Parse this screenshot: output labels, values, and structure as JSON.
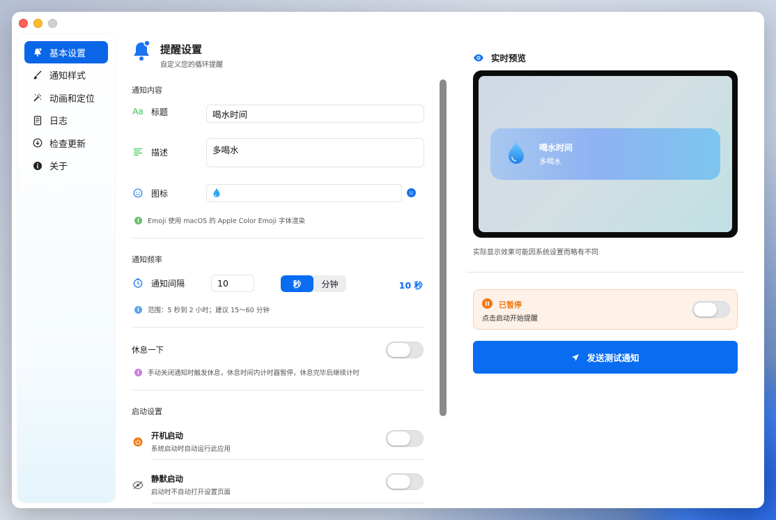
{
  "sidebar": {
    "items": [
      {
        "label": "基本设置",
        "icon": "bell-badge-icon"
      },
      {
        "label": "通知样式",
        "icon": "paintbrush-icon"
      },
      {
        "label": "动画和定位",
        "icon": "magic-wand-icon"
      },
      {
        "label": "日志",
        "icon": "document-icon"
      },
      {
        "label": "检查更新",
        "icon": "download-circle-icon"
      },
      {
        "label": "关于",
        "icon": "info-icon"
      }
    ]
  },
  "header": {
    "title": "提醒设置",
    "subtitle": "自定义您的循环提醒"
  },
  "content": {
    "section_label": "通知内容",
    "title_label": "标题",
    "title_value": "喝水时间",
    "desc_label": "描述",
    "desc_value": "多喝水",
    "icon_label": "图标",
    "icon_value": "💧",
    "emoji_hint": "Emoji 使用 macOS 的 Apple Color Emoji 字体渲染"
  },
  "frequency": {
    "section_label": "通知频率",
    "interval_label": "通知间隔",
    "interval_value": "10",
    "unit_seconds": "秒",
    "unit_minutes": "分钟",
    "selected_unit": "秒",
    "summary": "10 秒",
    "hint": "范围：5 秒到 2 小时；建议 15～60 分钟"
  },
  "rest": {
    "label": "休息一下",
    "enabled": false,
    "hint": "手动关闭通知时触发休息，休息时间内计时器暂停，休息完毕后继续计时"
  },
  "startup": {
    "section_label": "启动设置",
    "launch_title": "开机启动",
    "launch_sub": "系统启动时自动运行此应用",
    "launch_enabled": false,
    "silent_title": "静默启动",
    "silent_sub": "启动时不自动打开设置页面",
    "silent_enabled": false
  },
  "preview": {
    "title": "实时预览",
    "notif_emoji": "💧",
    "notif_title": "喝水时间",
    "notif_desc": "多喝水",
    "note": "实际显示效果可能因系统设置而略有不同"
  },
  "status": {
    "title": "已暂停",
    "subtitle": "点击启动开始提醒",
    "running": false
  },
  "actions": {
    "send_test": "发送测试通知"
  },
  "colors": {
    "accent": "#0a6cf0",
    "paused": "#f07a16",
    "green_icon": "#34c759",
    "info_purple": "#c77dde"
  }
}
